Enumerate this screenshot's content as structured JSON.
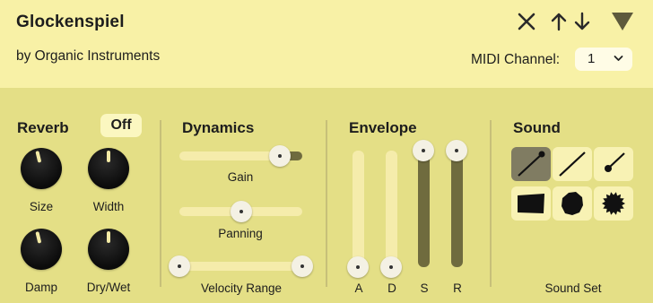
{
  "header": {
    "title": "Glockenspiel",
    "subtitle": "by Organic Instruments",
    "midi_label": "MIDI Channel:",
    "midi_value": "1",
    "icons": [
      "close-icon",
      "move-up-icon",
      "move-down-icon",
      "collapse-triangle-icon"
    ]
  },
  "reverb": {
    "title": "Reverb",
    "toggle_label": "Off",
    "knobs": [
      {
        "label": "Size",
        "value": 0.45
      },
      {
        "label": "Width",
        "value": 0.5
      },
      {
        "label": "Damp",
        "value": 0.45
      },
      {
        "label": "Dry/Wet",
        "value": 0.5
      }
    ]
  },
  "dynamics": {
    "title": "Dynamics",
    "gain": {
      "label": "Gain",
      "value": 0.82
    },
    "panning": {
      "label": "Panning",
      "value": 0.5
    },
    "velocity_range": {
      "label": "Velocity Range",
      "min": 0.0,
      "max": 1.0
    }
  },
  "envelope": {
    "title": "Envelope",
    "sliders": [
      {
        "label": "A",
        "value": 0.0
      },
      {
        "label": "D",
        "value": 0.0
      },
      {
        "label": "S",
        "value": 1.0
      },
      {
        "label": "R",
        "value": 1.0
      }
    ]
  },
  "sound": {
    "title": "Sound",
    "footer_label": "Sound Set",
    "selected_index": 0,
    "options": [
      "mallet-line-dot-icon",
      "mallet-line-icon",
      "mallet-short-dot-icon",
      "rectangle-shape-icon",
      "octagon-shape-icon",
      "starburst-shape-icon"
    ]
  },
  "colors": {
    "panel": "#e4df86",
    "header": "#f8f1a6",
    "track": "#f5ecab",
    "fill": "#6f6b3e",
    "knob": "#111111"
  }
}
